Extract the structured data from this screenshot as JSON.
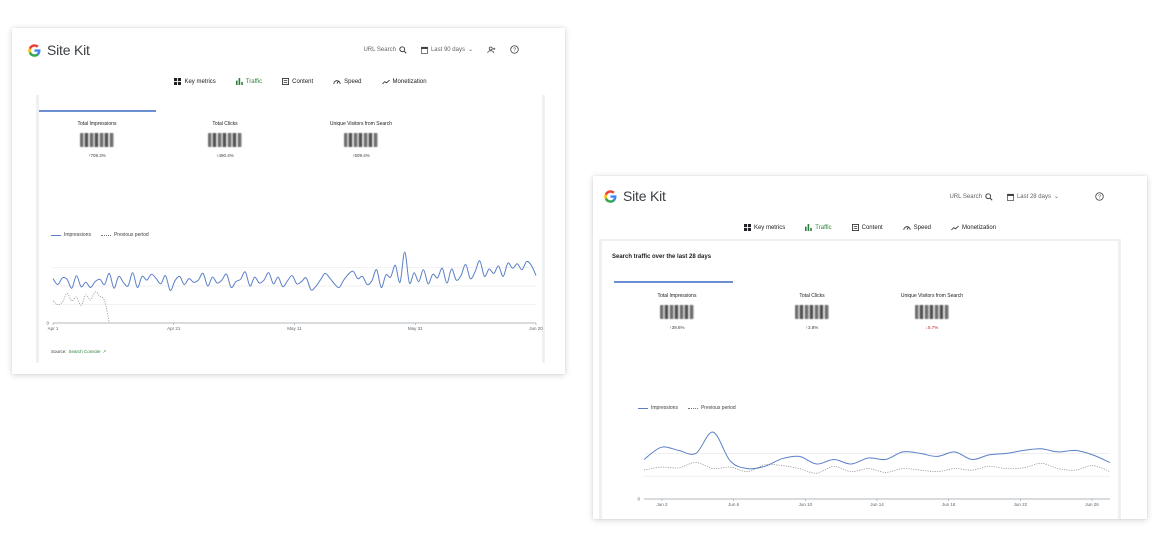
{
  "colors": {
    "accent_green": "#2a7f3a",
    "series_blue": "#5b7fc7",
    "previous_gray": "#888888"
  },
  "screenshots": [
    {
      "brand": "Site Kit",
      "header": {
        "url_search": "URL Search",
        "date_range": "Last 90 days",
        "icons": [
          "search-icon",
          "calendar-icon",
          "chevron-down-icon",
          "add-user-icon",
          "help-icon"
        ]
      },
      "tabs": [
        {
          "label": "Key metrics",
          "icon": "grid-icon"
        },
        {
          "label": "Traffic",
          "icon": "bar-chart-icon",
          "active": true
        },
        {
          "label": "Content",
          "icon": "content-icon"
        },
        {
          "label": "Speed",
          "icon": "speedometer-icon"
        },
        {
          "label": "Monetization",
          "icon": "trend-icon"
        }
      ],
      "metrics": [
        {
          "label": "Total Impressions",
          "change": "709.3%",
          "direction": "up"
        },
        {
          "label": "Total Clicks",
          "change": "490.4%",
          "direction": "up"
        },
        {
          "label": "Unique Visitors from Search",
          "change": "509.4%",
          "direction": "up"
        }
      ],
      "legend": [
        "Impressions",
        "Previous period"
      ],
      "source": {
        "prefix": "Source:",
        "link": "Search Console"
      },
      "chart_data": {
        "type": "line",
        "x_ticks": [
          "Apr 1",
          "Apr 21",
          "May 11",
          "May 31",
          "Jun 20"
        ],
        "y_ticks": [
          "0"
        ],
        "series": [
          {
            "name": "Impressions",
            "values": [
              60,
              52,
              61,
              59,
              47,
              64,
              49,
              55,
              48,
              56,
              59,
              52,
              67,
              47,
              63,
              55,
              50,
              68,
              48,
              63,
              58,
              66,
              60,
              53,
              64,
              44,
              57,
              63,
              52,
              60,
              55,
              58,
              67,
              50,
              62,
              54,
              58,
              66,
              48,
              56,
              59,
              69,
              50,
              62,
              54,
              58,
              68,
              53,
              62,
              49,
              57,
              64,
              53,
              56,
              61,
              45,
              49,
              58,
              67,
              61,
              53,
              48,
              58,
              66,
              70,
              60,
              63,
              52,
              57,
              72,
              48,
              65,
              62,
              78,
              55,
              96,
              54,
              68,
              56,
              72,
              53,
              66,
              61,
              74,
              54,
              73,
              58,
              64,
              79,
              60,
              69,
              84,
              63,
              73,
              67,
              77,
              63,
              81,
              74,
              80,
              72,
              83,
              78,
              64
            ]
          },
          {
            "name": "Previous period",
            "values": [
              30,
              25,
              28,
              40,
              30,
              35,
              24,
              38,
              31,
              42,
              36,
              30,
              0
            ]
          }
        ]
      }
    },
    {
      "brand": "Site Kit",
      "header": {
        "url_search": "URL Search",
        "date_range": "Last 28 days",
        "icons": [
          "search-icon",
          "calendar-icon",
          "chevron-down-icon",
          "help-icon"
        ]
      },
      "tabs": [
        {
          "label": "Key metrics",
          "icon": "grid-icon"
        },
        {
          "label": "Traffic",
          "icon": "bar-chart-icon",
          "active": true
        },
        {
          "label": "Content",
          "icon": "content-icon"
        },
        {
          "label": "Speed",
          "icon": "speedometer-icon"
        },
        {
          "label": "Monetization",
          "icon": "trend-icon"
        }
      ],
      "panel_title": "Search traffic over the last 28 days",
      "metrics": [
        {
          "label": "Total Impressions",
          "change": "39.6%",
          "direction": "up"
        },
        {
          "label": "Total Clicks",
          "change": "3.8%",
          "direction": "up"
        },
        {
          "label": "Unique Visitors from Search",
          "change": "5.7%",
          "direction": "down"
        }
      ],
      "legend": [
        "Impressions",
        "Previous period"
      ],
      "chart_data": {
        "type": "line",
        "x_ticks": [
          "Jun 2",
          "Jun 6",
          "Jun 10",
          "Jun 14",
          "Jun 18",
          "Jun 22",
          "Jun 26"
        ],
        "y_ticks": [
          "0"
        ],
        "series": [
          {
            "name": "Impressions",
            "values": [
              52,
              68,
              64,
              60,
              88,
              50,
              40,
              43,
              53,
              56,
              46,
              52,
              46,
              54,
              52,
              62,
              60,
              56,
              62,
              52,
              58,
              60,
              64,
              66,
              62,
              64,
              58,
              48
            ]
          },
          {
            "name": "Previous period",
            "values": [
              38,
              42,
              41,
              48,
              40,
              42,
              36,
              45,
              44,
              40,
              34,
              43,
              36,
              40,
              35,
              40,
              38,
              36,
              40,
              38,
              43,
              40,
              41,
              47,
              40,
              38,
              44,
              36
            ]
          }
        ]
      }
    }
  ]
}
